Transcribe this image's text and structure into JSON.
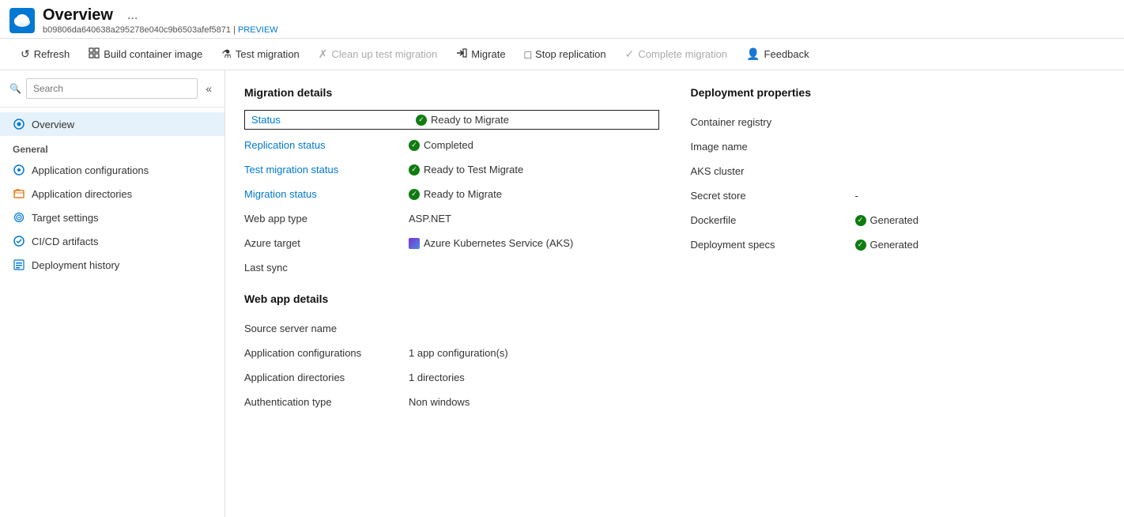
{
  "header": {
    "title": "Overview",
    "ellipsis": "...",
    "subtitle": "b09806da640638a295278e040c9b6503afef5871",
    "separator": "|",
    "preview_label": "PREVIEW"
  },
  "toolbar": {
    "buttons": [
      {
        "id": "refresh",
        "label": "Refresh",
        "icon": "↺",
        "enabled": true
      },
      {
        "id": "build-container-image",
        "label": "Build container image",
        "icon": "⊞",
        "enabled": true
      },
      {
        "id": "test-migration",
        "label": "Test migration",
        "icon": "⚗",
        "enabled": true
      },
      {
        "id": "clean-up-test-migration",
        "label": "Clean up test migration",
        "icon": "✗",
        "enabled": false
      },
      {
        "id": "migrate",
        "label": "Migrate",
        "icon": "⬡",
        "enabled": true
      },
      {
        "id": "stop-replication",
        "label": "Stop replication",
        "icon": "□",
        "enabled": true
      },
      {
        "id": "complete-migration",
        "label": "Complete migration",
        "icon": "✓",
        "enabled": false
      },
      {
        "id": "feedback",
        "label": "Feedback",
        "icon": "👤",
        "enabled": true
      }
    ]
  },
  "sidebar": {
    "search_placeholder": "Search",
    "overview_label": "Overview",
    "general_section": "General",
    "nav_items": [
      {
        "id": "overview",
        "label": "Overview",
        "active": true
      },
      {
        "id": "application-configurations",
        "label": "Application configurations",
        "active": false
      },
      {
        "id": "application-directories",
        "label": "Application directories",
        "active": false
      },
      {
        "id": "target-settings",
        "label": "Target settings",
        "active": false
      },
      {
        "id": "cicd-artifacts",
        "label": "CI/CD artifacts",
        "active": false
      },
      {
        "id": "deployment-history",
        "label": "Deployment history",
        "active": false
      }
    ]
  },
  "migration_details": {
    "section_title": "Migration details",
    "rows": [
      {
        "id": "status",
        "label": "Status",
        "value": "Ready to Migrate",
        "has_icon": true,
        "highlighted": true,
        "link_label": true
      },
      {
        "id": "replication-status",
        "label": "Replication status",
        "value": "Completed",
        "has_icon": true,
        "link_label": true
      },
      {
        "id": "test-migration-status",
        "label": "Test migration status",
        "value": "Ready to Test Migrate",
        "has_icon": true,
        "link_label": true
      },
      {
        "id": "migration-status",
        "label": "Migration status",
        "value": "Ready to Migrate",
        "has_icon": true,
        "link_label": true
      },
      {
        "id": "web-app-type",
        "label": "Web app type",
        "value": "ASP.NET",
        "has_icon": false,
        "link_label": false
      },
      {
        "id": "azure-target",
        "label": "Azure target",
        "value": "Azure Kubernetes Service (AKS)",
        "has_icon": true,
        "icon_type": "aks",
        "link_label": false
      },
      {
        "id": "last-sync",
        "label": "Last sync",
        "value": "",
        "has_icon": false,
        "link_label": false
      }
    ]
  },
  "deployment_properties": {
    "section_title": "Deployment properties",
    "rows": [
      {
        "id": "container-registry",
        "label": "Container registry",
        "value": "",
        "has_icon": false
      },
      {
        "id": "image-name",
        "label": "Image name",
        "value": "",
        "has_icon": false
      },
      {
        "id": "aks-cluster",
        "label": "AKS cluster",
        "value": "",
        "has_icon": false
      },
      {
        "id": "secret-store",
        "label": "Secret store",
        "value": "-",
        "has_icon": false
      },
      {
        "id": "dockerfile",
        "label": "Dockerfile",
        "value": "Generated",
        "has_icon": true
      },
      {
        "id": "deployment-specs",
        "label": "Deployment specs",
        "value": "Generated",
        "has_icon": true
      }
    ]
  },
  "web_app_details": {
    "section_title": "Web app details",
    "rows": [
      {
        "id": "source-server-name",
        "label": "Source server name",
        "value": ""
      },
      {
        "id": "application-configurations",
        "label": "Application configurations",
        "value": "1 app configuration(s)"
      },
      {
        "id": "application-directories",
        "label": "Application directories",
        "value": "1 directories"
      },
      {
        "id": "authentication-type",
        "label": "Authentication type",
        "value": "Non windows"
      }
    ]
  }
}
